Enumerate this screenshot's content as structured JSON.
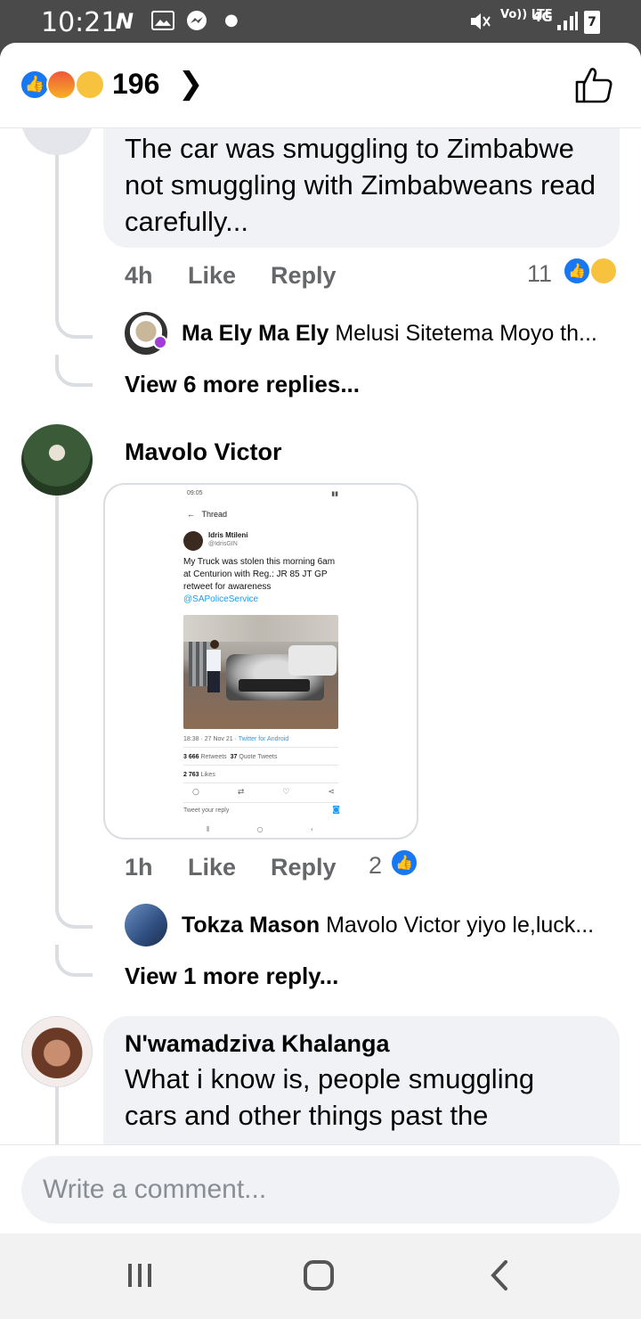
{
  "status_bar": {
    "time": "10:21",
    "notification_icons": [
      "n-icon",
      "gallery-icon",
      "messenger-icon",
      "dot-icon"
    ],
    "right_text": "Vo)) LTE",
    "network": "4G",
    "battery": "7"
  },
  "reactions": {
    "count": "196",
    "types": [
      "like",
      "angry",
      "sad"
    ]
  },
  "comments": [
    {
      "text": "The car was smuggling to Zimbabwe not smuggling with Zimbabweans read carefully...",
      "time": "4h",
      "like_label": "Like",
      "reply_label": "Reply",
      "reaction_count": "11",
      "reply_preview": {
        "name": "Ma Ely Ma Ely",
        "text": "Melusi Sitetema Moyo th..."
      },
      "view_more": "View 6 more replies..."
    },
    {
      "author": "Mavolo Victor",
      "time": "1h",
      "like_label": "Like",
      "reply_label": "Reply",
      "reaction_count": "2",
      "reply_preview": {
        "name": "Tokza Mason",
        "text": "Mavolo Victor yiyo le,luck..."
      },
      "view_more": "View 1 more reply..."
    },
    {
      "author": "N'wamadziva Khalanga",
      "text": "What i know is, people smuggling cars and other things past the"
    }
  ],
  "embedded_screenshot": {
    "time": "09:05",
    "header": "Thread",
    "author": "Idris Mtileni",
    "handle": "@IdrisGIN",
    "tweet": "My Truck  was stolen this morning 6am at Centurion with Reg.: JR 85 JT GP retweet for awareness",
    "mention": "@SAPoliceService",
    "meta_time": "18:38 · 27 Nov 21 · ",
    "meta_client": "Twitter for Android",
    "retweets": "3 666",
    "retweets_label": "Retweets",
    "quotes": "37",
    "quotes_label": "Quote Tweets",
    "likes": "2 763",
    "likes_label": "Likes",
    "reply_placeholder": "Tweet your reply"
  },
  "composer": {
    "placeholder": "Write a comment..."
  },
  "nav_bar": {
    "buttons": [
      "recent-apps",
      "home",
      "back"
    ]
  },
  "colors": {
    "facebook_blue": "#1877f2",
    "bubble_gray": "#f0f2f5",
    "meta_gray": "#65676b",
    "twitter_blue": "#1d9bf0"
  }
}
